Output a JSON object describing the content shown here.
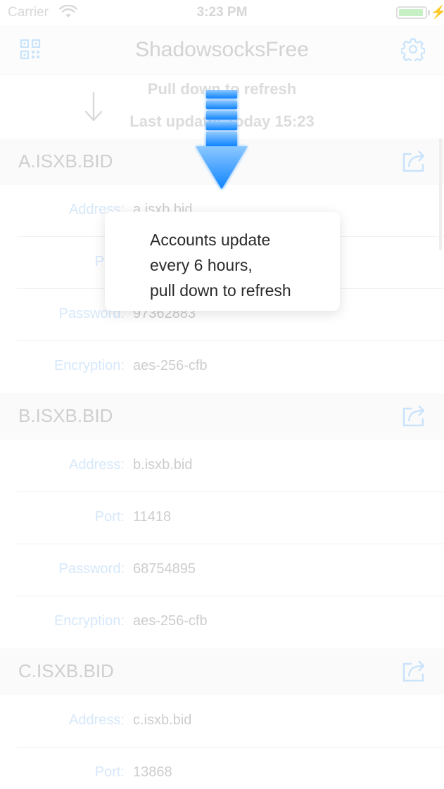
{
  "status_bar": {
    "carrier": "Carrier",
    "time": "3:23 PM",
    "battery_level": 0.95,
    "icons": [
      "wifi-icon",
      "battery-icon",
      "charging-bolt-icon"
    ]
  },
  "nav_bar": {
    "title": "ShadowsocksFree",
    "left_icon": "qr-code-icon",
    "right_icon": "gear-icon"
  },
  "refresh": {
    "pull_text": "Pull down to refresh",
    "last_update": "Last update: Today 15:23",
    "icon": "down-arrow-icon"
  },
  "sections": [
    {
      "title": "A.ISXB.BID",
      "share_icon": "share-icon",
      "rows": [
        {
          "label": "Address:",
          "value": "a.isxb.bid"
        },
        {
          "label": "Port:",
          "value": ""
        },
        {
          "label": "Password:",
          "value": "97362883"
        },
        {
          "label": "Encryption:",
          "value": "aes-256-cfb"
        }
      ]
    },
    {
      "title": "B.ISXB.BID",
      "share_icon": "share-icon",
      "rows": [
        {
          "label": "Address:",
          "value": "b.isxb.bid"
        },
        {
          "label": "Port:",
          "value": "11418"
        },
        {
          "label": "Password:",
          "value": "68754895"
        },
        {
          "label": "Encryption:",
          "value": "aes-256-cfb"
        }
      ]
    },
    {
      "title": "C.ISXB.BID",
      "share_icon": "share-icon",
      "rows": [
        {
          "label": "Address:",
          "value": "c.isxb.bid"
        },
        {
          "label": "Port:",
          "value": "13868"
        }
      ]
    }
  ],
  "tooltip": {
    "lines": [
      "Accounts update",
      "every 6 hours,",
      "pull down to refresh"
    ],
    "arrow_icon": "blue-down-arrow-icon"
  },
  "colors": {
    "accent": "#1a8cff",
    "dim_label": "#d6e8fa",
    "dim_text": "#cdcdcd"
  }
}
